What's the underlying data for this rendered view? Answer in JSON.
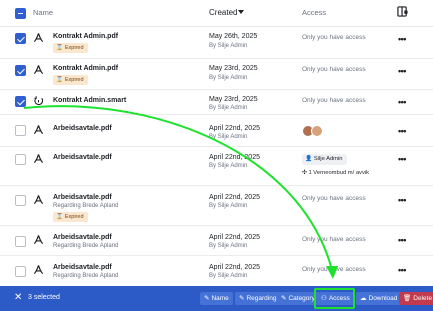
{
  "header": {
    "name_label": "Name",
    "created_label": "Created",
    "access_label": "Access",
    "select_all_state": "partial",
    "columns_icon": "columns-settings-icon",
    "sort_icon": "caret-down-icon"
  },
  "rows": [
    {
      "name": "Kontrakt Admin.pdf",
      "subtitle": "",
      "badge": "Expired",
      "date": "May 26th, 2025",
      "by": "By Silje Admin",
      "access": "Only you have access",
      "checked": true,
      "icon": "pdf-icon"
    },
    {
      "name": "Kontrakt Admin.pdf",
      "subtitle": "",
      "badge": "Expired",
      "date": "May 23rd, 2025",
      "by": "By Silje Admin",
      "access": "Only you have access",
      "checked": true,
      "icon": "pdf-icon"
    },
    {
      "name": "Kontrakt Admin.smart",
      "subtitle": "",
      "badge": "",
      "date": "May 23rd, 2025",
      "by": "By Silje Admin",
      "access": "Only you have access",
      "checked": true,
      "icon": "smart-doc-icon"
    },
    {
      "name": "Arbeidsavtale.pdf",
      "subtitle": "",
      "badge": "",
      "date": "April 22nd, 2025",
      "by": "By Silje Admin",
      "access": "",
      "checked": false,
      "icon": "pdf-icon",
      "access_avatars": [
        "avatar-1",
        "avatar-2"
      ]
    },
    {
      "name": "Arbeidsavtale.pdf",
      "subtitle": "",
      "badge": "",
      "date": "April 22nd, 2025",
      "by": "By Silje Admin",
      "access": "",
      "checked": false,
      "icon": "pdf-icon",
      "access_chips": [
        "Silje Admin",
        "1 Verneombud m/ avvik"
      ]
    },
    {
      "name": "Arbeidsavtale.pdf",
      "subtitle": "Regarding Brede Apland",
      "badge": "Expired",
      "date": "April 22nd, 2025",
      "by": "By Silje Admin",
      "access": "Only you have access",
      "checked": false,
      "icon": "pdf-icon"
    },
    {
      "name": "Arbeidsavtale.pdf",
      "subtitle": "Regarding Brede Apland",
      "badge": "",
      "date": "April 22nd, 2025",
      "by": "By Silje Admin",
      "access": "Only you have access",
      "checked": false,
      "icon": "pdf-icon"
    },
    {
      "name": "Arbeidsavtale.pdf",
      "subtitle": "Regarding Brede Apland",
      "badge": "",
      "date": "April 22nd, 2025",
      "by": "By Silje Admin",
      "access": "Only you have access",
      "checked": false,
      "icon": "pdf-icon"
    }
  ],
  "bottombar": {
    "selected_text": "3 selected",
    "name_btn": "Name",
    "regarding_btn": "Regarding",
    "category_btn": "Category",
    "access_btn": "Access",
    "download_btn": "Download",
    "delete_btn": "Delete"
  },
  "colors": {
    "accent": "#2c5bc7",
    "checkbox": "#2f5fd0",
    "expired_badge": "#fbe6cf",
    "delete": "#c33a4c",
    "annotation": "#1ee22e"
  }
}
